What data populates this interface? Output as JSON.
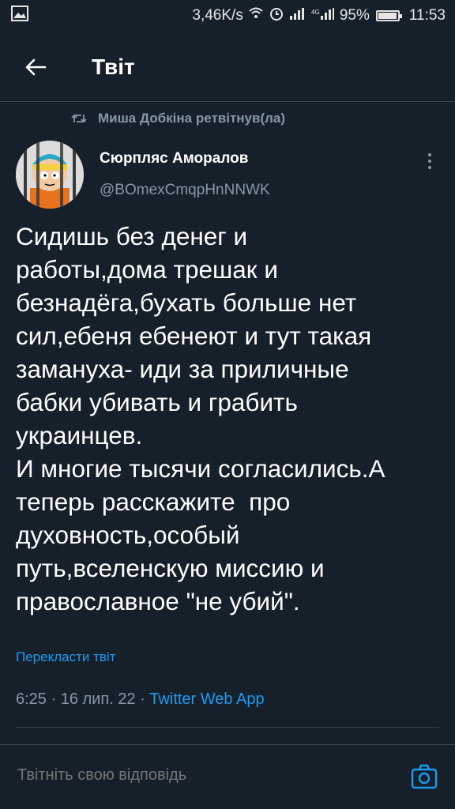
{
  "status_bar": {
    "speed": "3,46K/s",
    "battery": "95%",
    "time": "11:53"
  },
  "header": {
    "title": "Твіт"
  },
  "tweet": {
    "retweeted_by": "Миша Добкіна ретвітнув(ла)",
    "author_name": "Сюрпляс Аморалов",
    "author_handle": "@BOmexCmqpHnNNWK",
    "text": "Сидишь без денег и\nработы,дома трешак и\nбезнадёга,бухать больше нет\nсил,ебеня ебенеют и тут такая\nзамануха- иди за приличные\nбабки убивать и грабить\nукраинцев.\nИ многие тысячи согласились.А\nтеперь расскажите  про\nдуховность,особый\nпуть,вселенскую миссию и\nправославное \"не убий\".",
    "translate_label": "Перекласти твіт",
    "meta_time": "6:25 · 16 лип. 22 · ",
    "meta_app": "Twitter Web App"
  },
  "reply": {
    "placeholder": "Твітніть свою відповідь"
  },
  "colors": {
    "background": "#15202b",
    "accent": "#1d9bf0",
    "secondary_text": "#8899a6"
  }
}
